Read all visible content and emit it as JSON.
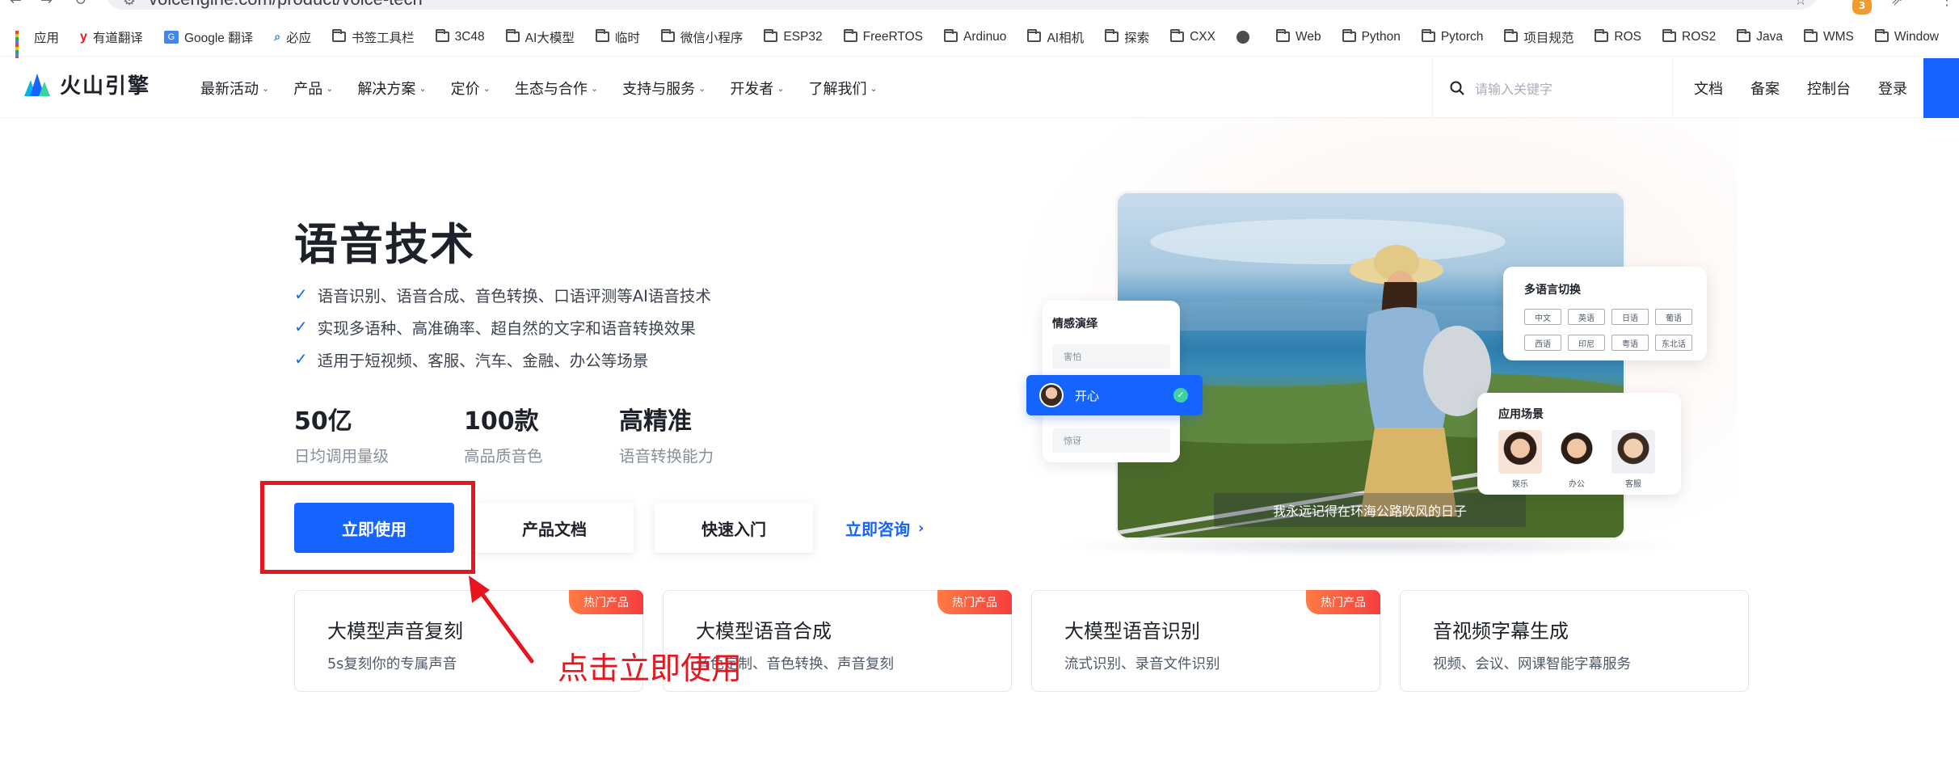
{
  "browser": {
    "url": "volcengine.com/product/voice-tech",
    "extension_badge": "3",
    "bookmarks": [
      {
        "label": "应用",
        "icon": "apps-grid-icon"
      },
      {
        "label": "有道翻译",
        "icon": "youdao-icon"
      },
      {
        "label": "Google 翻译",
        "icon": "google-translate-icon"
      },
      {
        "label": "必应",
        "icon": "bing-icon"
      },
      {
        "label": "书签工具栏",
        "icon": "folder-icon"
      },
      {
        "label": "3C48",
        "icon": "folder-icon"
      },
      {
        "label": "AI大模型",
        "icon": "folder-icon"
      },
      {
        "label": "临时",
        "icon": "folder-icon"
      },
      {
        "label": "微信小程序",
        "icon": "folder-icon"
      },
      {
        "label": "ESP32",
        "icon": "folder-icon"
      },
      {
        "label": "FreeRTOS",
        "icon": "folder-icon"
      },
      {
        "label": "Ardinuo",
        "icon": "folder-icon"
      },
      {
        "label": "AI相机",
        "icon": "folder-icon"
      },
      {
        "label": "探索",
        "icon": "folder-icon"
      },
      {
        "label": "CXX",
        "icon": "folder-icon"
      },
      {
        "label": "",
        "icon": "globe-icon"
      },
      {
        "label": "Web",
        "icon": "folder-icon"
      },
      {
        "label": "Python",
        "icon": "folder-icon"
      },
      {
        "label": "Pytorch",
        "icon": "folder-icon"
      },
      {
        "label": "项目规范",
        "icon": "folder-icon"
      },
      {
        "label": "ROS",
        "icon": "folder-icon"
      },
      {
        "label": "ROS2",
        "icon": "folder-icon"
      },
      {
        "label": "Java",
        "icon": "folder-icon"
      },
      {
        "label": "WMS",
        "icon": "folder-icon"
      },
      {
        "label": "Window",
        "icon": "folder-icon"
      }
    ]
  },
  "nav": {
    "logo_text": "火山引擎",
    "menu": [
      "最新活动",
      "产品",
      "解决方案",
      "定价",
      "生态与合作",
      "支持与服务",
      "开发者",
      "了解我们"
    ],
    "search_placeholder": "请输入关键字",
    "links": [
      "文档",
      "备案",
      "控制台",
      "登录"
    ]
  },
  "hero": {
    "title": "语音技术",
    "bullets": [
      "语音识别、语音合成、音色转换、口语评测等AI语音技术",
      "实现多语种、高准确率、超自然的文字和语音转换效果",
      "适用于短视频、客服、汽车、金融、办公等场景"
    ],
    "stats": [
      {
        "value": "50亿",
        "label": "日均调用量级"
      },
      {
        "value": "100款",
        "label": "高品质音色"
      },
      {
        "value": "高精准",
        "label": "语音转换能力"
      }
    ],
    "buttons": {
      "primary": "立即使用",
      "docs": "产品文档",
      "quickstart": "快速入门",
      "consult": "立即咨询"
    }
  },
  "illustration": {
    "caption": "我永远记得在环海公路吹风的日子",
    "emotion": {
      "title": "情感演绎",
      "options": [
        "害怕",
        "开心",
        "惊讶"
      ]
    },
    "languages": {
      "title": "多语言切换",
      "tags": [
        "中文",
        "英语",
        "日语",
        "葡语",
        "西语",
        "印尼",
        "粤语",
        "东北话"
      ]
    },
    "scenes": {
      "title": "应用场景",
      "items": [
        "娱乐",
        "办公",
        "客服"
      ]
    }
  },
  "products": [
    {
      "title": "大模型声音复刻",
      "desc": "5s复刻你的专属声音",
      "tag": "热门产品"
    },
    {
      "title": "大模型语音合成",
      "desc": "音色定制、音色转换、声音复刻",
      "tag": "热门产品"
    },
    {
      "title": "大模型语音识别",
      "desc": "流式识别、录音文件识别",
      "tag": "热门产品"
    },
    {
      "title": "音视频字幕生成",
      "desc": "视频、会议、网课智能字幕服务",
      "tag": ""
    }
  ],
  "annotation": {
    "text": "点击立即使用",
    "color": "#e8151f"
  },
  "colors": {
    "brand_blue": "#1664ff",
    "hot_tag": "#f53f3f",
    "highlight_red": "#e8151f"
  }
}
